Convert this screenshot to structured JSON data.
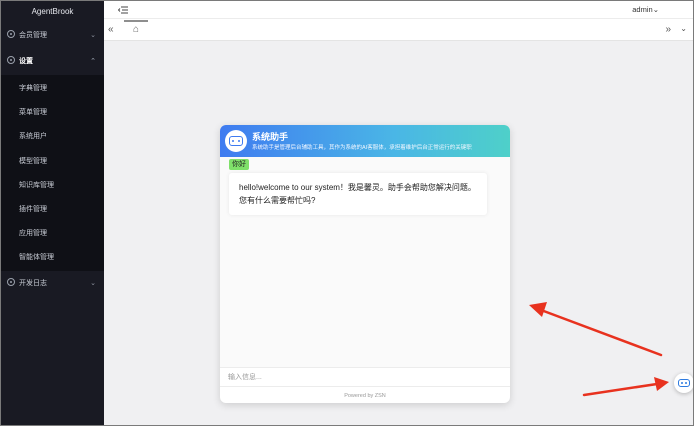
{
  "sidebar": {
    "brand": "AgentBrook",
    "menus": [
      {
        "label": "会员管理",
        "chevron": "⌄"
      },
      {
        "label": "设置",
        "chevron": "⌃"
      }
    ],
    "settings_items": [
      "字典管理",
      "菜单管理",
      "系统用户",
      "模型管理",
      "知识库管理",
      "插件管理",
      "应用管理",
      "智能体管理"
    ],
    "bottom_menu": {
      "label": "开发日志",
      "chevron": "⌄"
    }
  },
  "header": {
    "user": "admin",
    "user_chevron": "⌄"
  },
  "tagsbar": {
    "left_glyph": "«",
    "home_glyph": "⌂",
    "right_glyph": "»",
    "more_glyph": "⌄"
  },
  "chat": {
    "title": "系统助手",
    "subtitle": "系统助手是管理后台辅助工具，其作为系统的AI客服体，承担着维护后台正常运行的关键职",
    "user_message": "你好",
    "bot_message_line1": "hello!welcome to our system！我是馨灵。助手会帮助您解决问题。",
    "bot_message_line2": "您有什么需要帮忙吗?",
    "input_placeholder": "输入信息...",
    "powered_by": "Powered by ZSN"
  },
  "colors": {
    "sidebar_bg": "#191a23",
    "header_gradient_start": "#3f7bf0",
    "header_gradient_end": "#4ed0c9",
    "user_bubble": "#7fe06a",
    "annotation_arrow": "#e8321f"
  }
}
